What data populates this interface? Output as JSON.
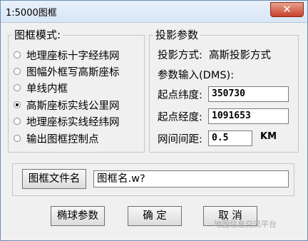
{
  "window": {
    "title": "1:5000图框",
    "close_glyph": "✕"
  },
  "frame_mode": {
    "title": "图框模式:",
    "options": [
      {
        "label": "地理座标十字经纬网",
        "checked": false
      },
      {
        "label": "图幅外框写高斯座标",
        "checked": false
      },
      {
        "label": "单线内框",
        "checked": false
      },
      {
        "label": "高斯座标实线公里网",
        "checked": true
      },
      {
        "label": "地理座标实线经纬网",
        "checked": false
      },
      {
        "label": "输出图框控制点",
        "checked": false
      }
    ]
  },
  "projection": {
    "title": "投影参数",
    "method_label": "投影方式:",
    "method_value": "高斯投影方式",
    "dms_label": "参数输入(DMS):",
    "lat_label": "起点纬度:",
    "lat_value": "350730",
    "lon_label": "起点经度:",
    "lon_value": "1091653",
    "grid_label": "网间间距:",
    "grid_value": "0.5",
    "grid_unit": "KM"
  },
  "file": {
    "button_label": "图框文件名",
    "input_value": "图框名.w?"
  },
  "buttons": {
    "ellipsoid": "椭球参数",
    "ok": "确 定",
    "cancel": "取 消"
  },
  "watermark": "地图信息交流平台"
}
